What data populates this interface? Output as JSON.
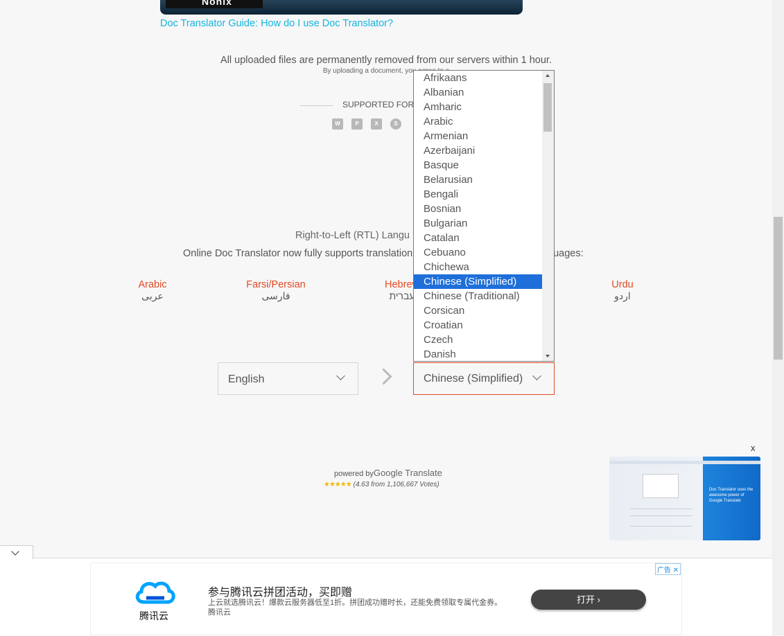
{
  "video_banner": {
    "text": "Nonix"
  },
  "guide_link": "Doc Translator Guide: How do I use Doc Translator?",
  "notice": {
    "main": "All uploaded files are permanently removed from our servers within 1 hour.",
    "sub": "By uploading a document, you agree to o"
  },
  "formats": {
    "label": "SUPPORTED FORM",
    "icons": [
      "word-icon",
      "powerpoint-icon",
      "excel-icon",
      "subtitle-icon"
    ]
  },
  "rtl": {
    "title": "Right-to-Left (RTL) Langu",
    "desc_left": "Online Doc Translator now fully supports translation",
    "desc_right": "guages:",
    "languages": [
      {
        "en": "Arabic",
        "native": "عربى"
      },
      {
        "en": "Farsi/Persian",
        "native": "فارسی"
      },
      {
        "en": "Hebrew",
        "native": "עברית"
      },
      {
        "en": "Urdu",
        "native": "اردو"
      }
    ]
  },
  "selectors": {
    "source": "English",
    "target": "Chinese (Simplified)"
  },
  "dropdown": {
    "items": [
      "Afrikaans",
      "Albanian",
      "Amharic",
      "Arabic",
      "Armenian",
      "Azerbaijani",
      "Basque",
      "Belarusian",
      "Bengali",
      "Bosnian",
      "Bulgarian",
      "Catalan",
      "Cebuano",
      "Chichewa",
      "Chinese (Simplified)",
      "Chinese (Traditional)",
      "Corsican",
      "Croatian",
      "Czech",
      "Danish"
    ],
    "selected_index": 14
  },
  "powered": {
    "prefix": "powered by",
    "brand": "Google Translate",
    "votes": "(4.63 from 1,106,667 Votes)",
    "rating": 4.63
  },
  "side_ad": {
    "close": "x",
    "text": "Doc Translator uses the awesome power of Google Translate"
  },
  "bottom_ad": {
    "badge": "广告",
    "badge_close": "✕",
    "logo_text": "腾讯云",
    "title": "参与腾讯云拼团活动，买即赠",
    "desc": "上云就选腾讯云！爆款云服务器低至1折。拼团成功赠时长，还能免费领取专属代金券。 腾讯云",
    "cta": "打开"
  },
  "colors": {
    "accent": "#e04a25",
    "link": "#14b4e0",
    "selected": "#1e6fd9"
  }
}
